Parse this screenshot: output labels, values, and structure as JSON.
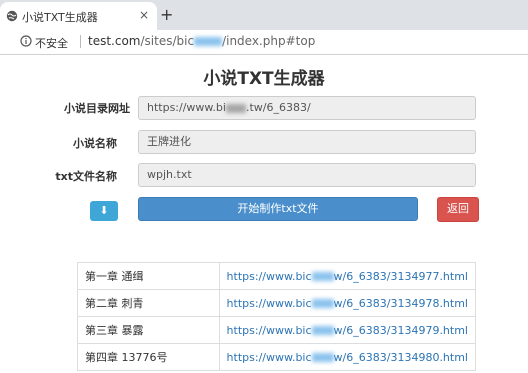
{
  "browser": {
    "tab_title": "小说TXT生成器",
    "tab_close_glyph": "×",
    "new_tab_glyph": "+",
    "insecure_label": "不安全",
    "url_host": "test.com",
    "url_path_start": "/sites/bic",
    "url_path_end": "/index.php#top"
  },
  "page": {
    "title": "小说TXT生成器"
  },
  "form": {
    "url_label": "小说目录网址",
    "url_value": "https://www.bi",
    "url_value_end": ".tw/6_6383/",
    "name_label": "小说名称",
    "name_value": "王牌进化",
    "file_label": "txt文件名称",
    "file_value": "wpjh.txt",
    "download_glyph": "⬇",
    "start_label": "开始制作txt文件",
    "back_label": "返回"
  },
  "chapters": [
    {
      "title": "第一章 通缉",
      "link_start": "https://www.bic",
      "link_end": "w/6_6383/3134977.html"
    },
    {
      "title": "第二章 刺青",
      "link_start": "https://www.bic",
      "link_end": "w/6_6383/3134978.html"
    },
    {
      "title": "第三章 暴露",
      "link_start": "https://www.bic",
      "link_end": "w/6_6383/3134979.html"
    },
    {
      "title": "第四章 13776号",
      "link_start": "https://www.bic",
      "link_end": "w/6_6383/3134980.html"
    }
  ],
  "colors": {
    "primary": "#4a8fcc",
    "info": "#3fa6d8",
    "danger": "#d9534f",
    "link": "#2c74b5"
  }
}
